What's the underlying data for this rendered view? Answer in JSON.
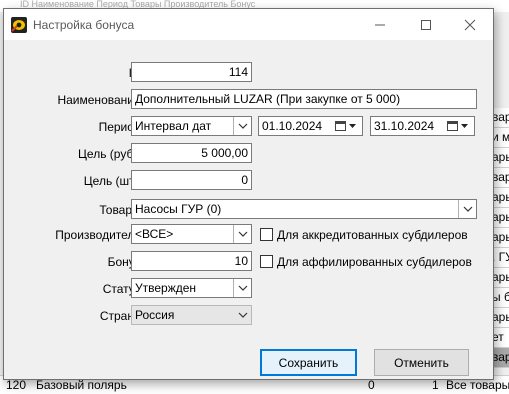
{
  "background": {
    "top_fragment": "ID  Наименование  Период  Товары  Производитель  Бонус",
    "right_column": [
      "вары",
      "и ма",
      "ары",
      "вары",
      "ары",
      "ары",
      "ары",
      ". ГУ",
      "ары",
      "ы бо",
      "ары",
      "ет",
      "вары"
    ],
    "bottom_row": {
      "id": "120",
      "name": "Базовый полярь",
      "c1": "0",
      "c2": "1",
      "goods": "Все товары"
    }
  },
  "dialog": {
    "title": "Настройка бонуса",
    "icons": {
      "app": "app-logo-icon",
      "minimize": "minimize-icon",
      "maximize": "maximize-icon",
      "close": "close-icon"
    },
    "fields": {
      "id": {
        "label": "ID:",
        "value": "114"
      },
      "name": {
        "label": "Наименование:",
        "value": "Дополнительный LUZAR (При закупке от 5 000)"
      },
      "period": {
        "label": "Период:",
        "type_value": "Интервал дат",
        "date_from": "01.10.2024",
        "date_to": "31.10.2024"
      },
      "target_rub": {
        "label": "Цель (руб.):",
        "value": "5 000,00"
      },
      "target_pcs": {
        "label": "Цель (шт.):",
        "value": "0"
      },
      "goods": {
        "label": "Товары:",
        "value": "Насосы ГУР (0)"
      },
      "manufacturer": {
        "label": "Производитель:",
        "value": "<ВСЕ>"
      },
      "bonus": {
        "label": "Бонус:",
        "value": "10"
      },
      "status": {
        "label": "Статус:",
        "value": "Утвержден"
      },
      "country": {
        "label": "Страна:",
        "value": "Россия"
      }
    },
    "checkboxes": {
      "accredited": {
        "label": "Для аккредитованных субдилеров",
        "checked": false
      },
      "affiliated": {
        "label": "Для аффилированных субдилеров",
        "checked": false
      }
    },
    "buttons": {
      "save": "Сохранить",
      "cancel": "Отменить"
    }
  }
}
